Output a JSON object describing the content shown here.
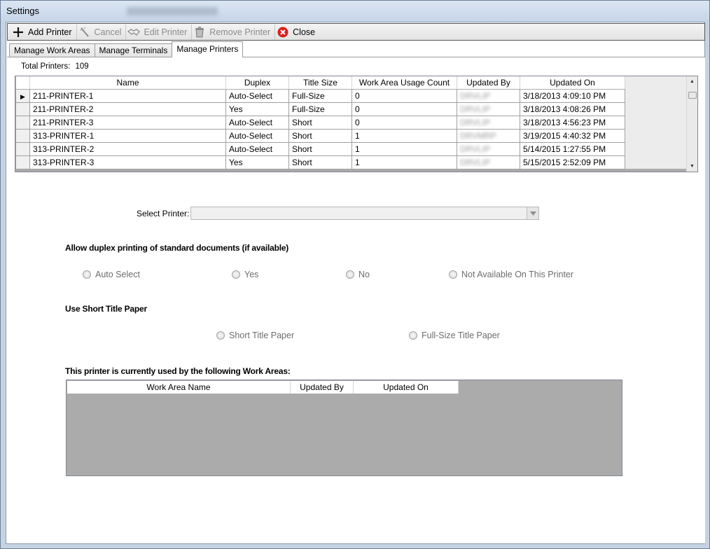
{
  "window": {
    "title": "Settings",
    "background_title": "Agency Bulletins"
  },
  "toolbar": {
    "add": "Add Printer",
    "cancel": "Cancel",
    "edit": "Edit Printer",
    "remove": "Remove Printer",
    "close": "Close"
  },
  "tabs": [
    "Manage Work Areas",
    "Manage Terminals",
    "Manage Printers"
  ],
  "total": {
    "label": "Total Printers:",
    "value": "109"
  },
  "grid": {
    "columns": [
      "Name",
      "Duplex",
      "Title Size",
      "Work Area Usage Count",
      "Updated By",
      "Updated On"
    ],
    "rows": [
      {
        "name": "211-PRINTER-1",
        "duplex": "Auto-Select",
        "title_size": "Full-Size",
        "count": "0",
        "updated_by": "DRVLIP",
        "updated_on": "3/18/2013 4:09:10 PM"
      },
      {
        "name": "211-PRINTER-2",
        "duplex": "Yes",
        "title_size": "Full-Size",
        "count": "0",
        "updated_by": "DRVLIP",
        "updated_on": "3/18/2013 4:08:26 PM"
      },
      {
        "name": "211-PRINTER-3",
        "duplex": "Auto-Select",
        "title_size": "Short",
        "count": "0",
        "updated_by": "DRVLIP",
        "updated_on": "3/18/2013 4:56:23 PM"
      },
      {
        "name": "313-PRINTER-1",
        "duplex": "Auto-Select",
        "title_size": "Short",
        "count": "1",
        "updated_by": "DRVMRP",
        "updated_on": "3/19/2015 4:40:32 PM"
      },
      {
        "name": "313-PRINTER-2",
        "duplex": "Auto-Select",
        "title_size": "Short",
        "count": "1",
        "updated_by": "DRVLIP",
        "updated_on": "5/14/2015 1:27:55 PM"
      },
      {
        "name": "313-PRINTER-3",
        "duplex": "Yes",
        "title_size": "Short",
        "count": "1",
        "updated_by": "DRVLIP",
        "updated_on": "5/15/2015 2:52:09 PM"
      }
    ]
  },
  "select_printer": {
    "label": "Select Printer:",
    "value": ""
  },
  "duplex_section": {
    "title": "Allow duplex printing of standard documents (if available)",
    "options": [
      "Auto Select",
      "Yes",
      "No",
      "Not Available On This Printer"
    ]
  },
  "paper_section": {
    "title": "Use Short Title Paper",
    "options": [
      "Short Title Paper",
      "Full-Size Title Paper"
    ]
  },
  "usage_section": {
    "title": "This printer is currently used by the following Work Areas:",
    "columns": [
      "Work Area Name",
      "Updated By",
      "Updated On"
    ]
  },
  "colors": {
    "close_icon": "#d9201f",
    "grid_bg": "#ababab"
  }
}
